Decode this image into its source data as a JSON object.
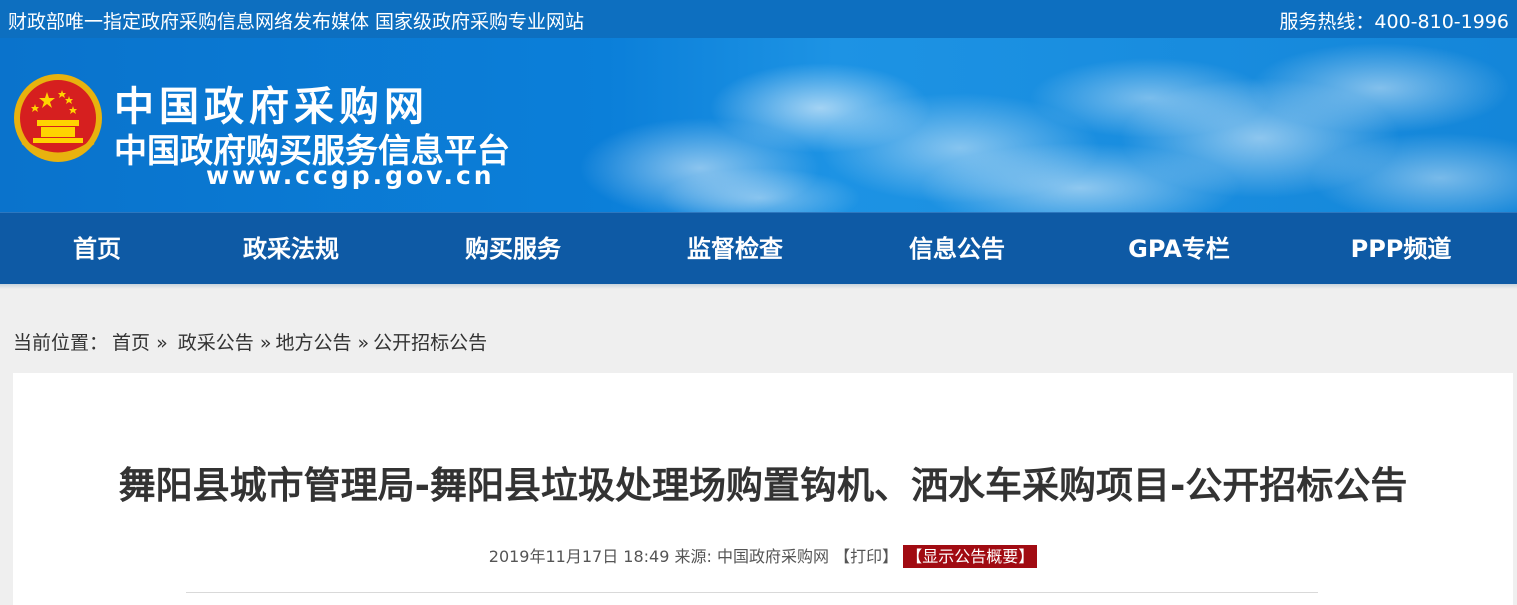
{
  "topbar": {
    "slogan": "财政部唯一指定政府采购信息网络发布媒体 国家级政府采购专业网站",
    "hotline": "服务热线：400-810-1996"
  },
  "banner": {
    "title_main": "中国政府采购网",
    "title_sub": "中国政府购买服务信息平台",
    "url": "www.ccgp.gov.cn",
    "emblem_icon": "national-emblem-icon"
  },
  "nav": {
    "items": [
      "首页",
      "政采法规",
      "购买服务",
      "监督检查",
      "信息公告",
      "GPA专栏",
      "PPP频道"
    ]
  },
  "breadcrumb": {
    "prefix": "当前位置：",
    "items": [
      "首页",
      "政采公告",
      "地方公告",
      "公开招标公告"
    ],
    "separator": "»"
  },
  "article": {
    "title": "舞阳县城市管理局-舞阳县垃圾处理场购置钩机、洒水车采购项目-公开招标公告",
    "datetime": "2019年11月17日 18:49",
    "source_label": "来源:",
    "source": "中国政府采购网",
    "print_label": "【打印】",
    "summary_label": "【显示公告概要】"
  },
  "colors": {
    "topbar": "#0d6fc0",
    "nav": "#0e5aa5",
    "summary_badge": "#a10b12"
  }
}
